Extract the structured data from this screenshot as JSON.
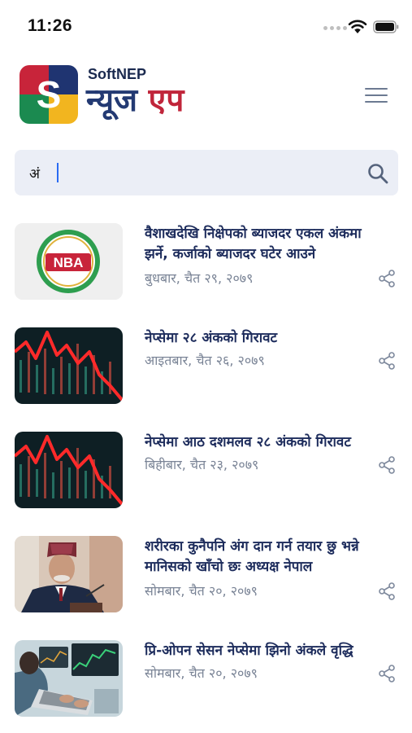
{
  "status_bar": {
    "time": "11:26"
  },
  "header": {
    "brand_name": "SoftNEP",
    "brand_title_part1": "न्यूज",
    "brand_title_part2": "एप",
    "logo_letter": "S"
  },
  "search": {
    "value": "अं",
    "placeholder": ""
  },
  "news": [
    {
      "title": "वैशाखदेखि निक्षेपको ब्याजदर एकल अंकमा झर्ने, कर्जाको ब्याजदर घटेर आउने",
      "date": "बुधबार, चैत २९, २०७९",
      "thumb_text": "NBA"
    },
    {
      "title": "नेप्सेमा २८ अंकको गिरावट",
      "date": "आइतबार, चैत २६, २०७९"
    },
    {
      "title": "नेप्सेमा आठ दशमलव २८ अंकको गिरावट",
      "date": "बिहीबार, चैत २३, २०७९"
    },
    {
      "title": "शरीरका कुनैपनि अंग दान गर्न तयार छु भन्ने मानिसको खाँचो छः अध्यक्ष नेपाल",
      "date": "सोमबार, चैत २०, २०७९"
    },
    {
      "title": "प्रि-ओपन सेसन नेप्सेमा झिनो अंकले वृद्धि",
      "date": "सोमबार, चैत २०, २०७९"
    }
  ],
  "colors": {
    "brand_blue": "#233a73",
    "brand_red": "#c0253a",
    "search_bg": "#ebeef6",
    "date_gray": "#7a8496"
  }
}
